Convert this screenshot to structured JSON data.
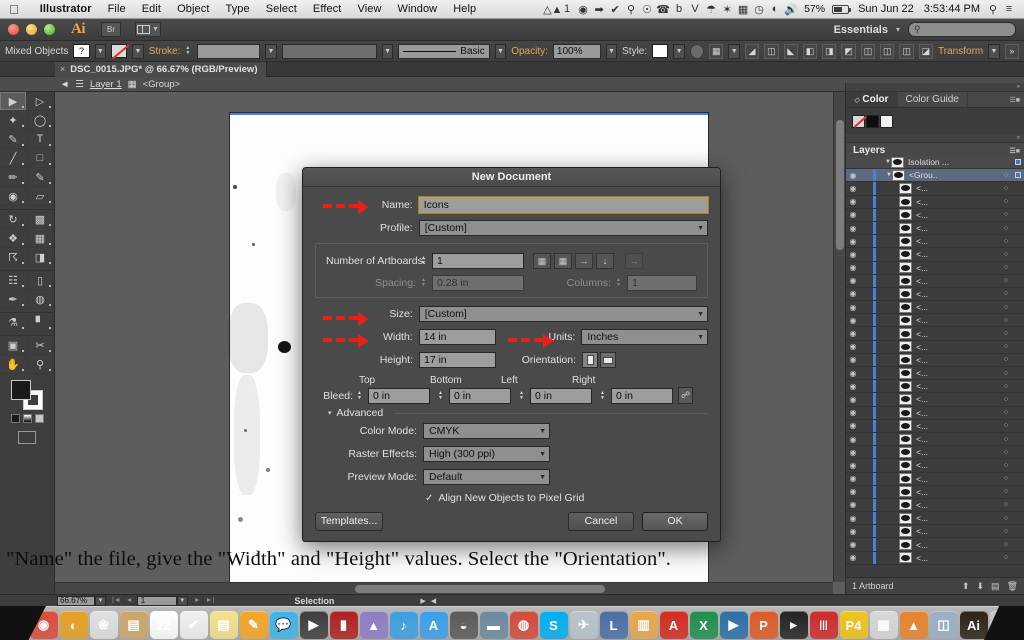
{
  "macbar": {
    "apple": "apple-logo",
    "menus": [
      "Illustrator",
      "File",
      "Edit",
      "Object",
      "Type",
      "Select",
      "Effect",
      "View",
      "Window",
      "Help"
    ],
    "status_items": [
      "Ⅶ",
      "1",
      "⚙",
      "➡",
      "◉",
      "♀",
      "⌂",
      "☎",
      "b",
      "V²",
      "☂",
      "✳",
      "▦",
      "◷"
    ],
    "battery_percent": "57%",
    "date": "Sun Jun 22",
    "time": "3:53:44 PM",
    "search_icon": "search-icon",
    "list_icon": "notification-center-icon"
  },
  "appbar": {
    "app_logo": "Ai",
    "bridge_label": "Br",
    "workspace": "Essentials",
    "workspace_caret": "▾",
    "search_placeholder": ""
  },
  "controlbar": {
    "selection_label": "Mixed Objects",
    "fill_value": "?",
    "stroke_label": "Stroke:",
    "stroke_weight": "",
    "profile_label": "Basic",
    "opacity_label": "Opacity:",
    "opacity_value": "100%",
    "style_label": "Style:",
    "transform_label": "Transform",
    "align_icons": [
      "align-left-icon",
      "align-center-h-icon",
      "align-right-icon",
      "align-top-icon",
      "align-middle-icon",
      "align-bottom-icon",
      "distribute-left-icon",
      "distribute-center-icon",
      "distribute-right-icon",
      "distribute-spacing-icon"
    ]
  },
  "document": {
    "tab_title": "DSC_0015.JPG* @ 66.67% (RGB/Preview)",
    "tab_close": "×",
    "breadcrumb_back": "◄",
    "breadcrumb_layer": "Layer 1",
    "breadcrumb_group": "<Group>"
  },
  "toolbox": {
    "tools": [
      "selection-tool",
      "direct-selection-tool",
      "magic-wand-tool",
      "lasso-tool",
      "pen-tool",
      "type-tool",
      "line-segment-tool",
      "rectangle-tool",
      "paintbrush-tool",
      "pencil-tool",
      "blob-brush-tool",
      "eraser-tool",
      "rotate-tool",
      "scale-tool",
      "width-tool",
      "free-transform-tool",
      "shape-builder-tool",
      "perspective-grid-tool",
      "mesh-tool",
      "gradient-tool",
      "eyedropper-tool",
      "blend-tool",
      "symbol-sprayer-tool",
      "column-graph-tool",
      "artboard-tool",
      "slice-tool",
      "hand-tool",
      "zoom-tool"
    ],
    "fill_swatch": "fill-swatch",
    "stroke_swatch": "stroke-swatch",
    "screen_mode": "screen-mode-icon"
  },
  "dialog": {
    "title": "New Document",
    "name_label": "Name:",
    "name_value": "Icons",
    "profile_label": "Profile:",
    "profile_value": "[Custom]",
    "artboards_label": "Number of Artboards:",
    "artboards_value": "1",
    "artboard_layout_icons": [
      "grid-by-row-icon",
      "grid-by-column-icon",
      "arrange-by-row-icon",
      "arrange-by-column-icon",
      "change-to-right-to-left-icon"
    ],
    "spacing_label": "Spacing:",
    "spacing_value": "0.28 in",
    "columns_label": "Columns:",
    "columns_value": "1",
    "size_label": "Size:",
    "size_value": "[Custom]",
    "width_label": "Width:",
    "width_value": "14 in",
    "units_label": "Units:",
    "units_value": "Inches",
    "height_label": "Height:",
    "height_value": "17 in",
    "orientation_label": "Orientation:",
    "orientation_portrait": "portrait-orientation-icon",
    "orientation_landscape": "landscape-orientation-icon",
    "bleed_label": "Bleed:",
    "bleed_headers": [
      "Top",
      "Bottom",
      "Left",
      "Right"
    ],
    "bleed_values": [
      "0 in",
      "0 in",
      "0 in",
      "0 in"
    ],
    "bleed_link": "link-bleed-icon",
    "advanced_label": "Advanced",
    "advanced_triangle": "▾",
    "color_mode_label": "Color Mode:",
    "color_mode_value": "CMYK",
    "raster_label": "Raster Effects:",
    "raster_value": "High (300 ppi)",
    "preview_label": "Preview Mode:",
    "preview_value": "Default",
    "align_pixel_label": "Align New Objects to Pixel Grid",
    "align_pixel_checked": "✓",
    "templates_button": "Templates...",
    "cancel_button": "Cancel",
    "ok_button": "OK"
  },
  "annotations": {
    "arrow_color": "#e8201a",
    "arrows": [
      "name-arrow",
      "width-arrow",
      "height-arrow",
      "orientation-arrow"
    ]
  },
  "panels": {
    "color_tab": "Color",
    "color_guide_tab": "Color Guide",
    "layers_tab": "Layers",
    "layer_rows": [
      {
        "name": "Isolation ...",
        "type": "isolation"
      },
      {
        "name": "<Grou..",
        "type": "group-selected"
      },
      {
        "name": "<...",
        "type": "item"
      },
      {
        "name": "<...",
        "type": "item"
      },
      {
        "name": "<...",
        "type": "item"
      },
      {
        "name": "<...",
        "type": "item"
      },
      {
        "name": "<...",
        "type": "item"
      },
      {
        "name": "<...",
        "type": "item"
      },
      {
        "name": "<...",
        "type": "item"
      },
      {
        "name": "<...",
        "type": "item"
      },
      {
        "name": "<...",
        "type": "item"
      },
      {
        "name": "<...",
        "type": "item"
      },
      {
        "name": "<...",
        "type": "item"
      },
      {
        "name": "<...",
        "type": "item"
      },
      {
        "name": "<...",
        "type": "item"
      },
      {
        "name": "<...",
        "type": "item"
      },
      {
        "name": "<...",
        "type": "item"
      },
      {
        "name": "<...",
        "type": "item"
      },
      {
        "name": "<...",
        "type": "item"
      },
      {
        "name": "<...",
        "type": "item"
      },
      {
        "name": "<...",
        "type": "item"
      },
      {
        "name": "<...",
        "type": "item"
      },
      {
        "name": "<...",
        "type": "item"
      },
      {
        "name": "<...",
        "type": "item"
      },
      {
        "name": "<...",
        "type": "item"
      },
      {
        "name": "<...",
        "type": "item"
      },
      {
        "name": "<...",
        "type": "item"
      },
      {
        "name": "<...",
        "type": "item"
      },
      {
        "name": "<...",
        "type": "item"
      },
      {
        "name": "<...",
        "type": "item"
      },
      {
        "name": "<...",
        "type": "item"
      }
    ],
    "layers_footer_icons": [
      "make-clipping-mask-icon",
      "create-sublayer-icon",
      "create-layer-icon",
      "delete-layer-icon"
    ]
  },
  "statusbar": {
    "zoom_value": "66.67%",
    "page_value": "1",
    "tool_label": "Selection",
    "artboard_label": "1 Artboard",
    "nav_first": "|◄",
    "nav_prev": "◄",
    "nav_next": "►",
    "nav_last": "►|"
  },
  "caption": {
    "text": "\"Name\" the file, give the \"Width\" and \"Height\" values. Select the \"Orientation\"."
  },
  "dock": {
    "items": [
      {
        "name": "finder",
        "glyph": "☺",
        "color": "#4a90d9"
      },
      {
        "name": "launchpad",
        "glyph": "🚀",
        "color": "#b9bcc1"
      },
      {
        "name": "system-preferences",
        "glyph": "⚙",
        "color": "#7d8289"
      },
      {
        "name": "safari",
        "glyph": "◎",
        "color": "#2e8fd6"
      },
      {
        "name": "mail",
        "glyph": "✉",
        "color": "#3f8fe0"
      },
      {
        "name": "chrome",
        "glyph": "◉",
        "color": "#dd4b39"
      },
      {
        "name": "firefox",
        "glyph": "◐",
        "color": "#e8a020"
      },
      {
        "name": "photos",
        "glyph": "❀",
        "color": "#e0e0e0"
      },
      {
        "name": "documents-folder",
        "glyph": "▤",
        "color": "#cba56a"
      },
      {
        "name": "calendar",
        "glyph": "22",
        "color": "#ffffff"
      },
      {
        "name": "reminders",
        "glyph": "✔",
        "color": "#f0f0f0"
      },
      {
        "name": "notes",
        "glyph": "▤",
        "color": "#f2e28a"
      },
      {
        "name": "pages",
        "glyph": "✎",
        "color": "#f5a623"
      },
      {
        "name": "messages",
        "glyph": "💬",
        "color": "#3fb4e8"
      },
      {
        "name": "facetime",
        "glyph": "▶",
        "color": "#3d3d3d"
      },
      {
        "name": "books",
        "glyph": "▮",
        "color": "#b02020"
      },
      {
        "name": "itunes-movie",
        "glyph": "▲",
        "color": "#8e7cc3"
      },
      {
        "name": "itunes",
        "glyph": "♪",
        "color": "#3aa0e0"
      },
      {
        "name": "app-store",
        "glyph": "A",
        "color": "#39a0ec"
      },
      {
        "name": "ubuntu",
        "glyph": "◒",
        "color": "#5a5a5a"
      },
      {
        "name": "vmware",
        "glyph": "▬",
        "color": "#6d8aa0"
      },
      {
        "name": "popcorn-time",
        "glyph": "◍",
        "color": "#d44a3a"
      },
      {
        "name": "skype",
        "glyph": "S",
        "color": "#00aff0"
      },
      {
        "name": "disk-utility",
        "glyph": "✈",
        "color": "#b8c4cc"
      },
      {
        "name": "textedit",
        "glyph": "L",
        "color": "#4a6fa5"
      },
      {
        "name": "keynote",
        "glyph": "▥",
        "color": "#e8a84a"
      },
      {
        "name": "acrobat",
        "glyph": "A",
        "color": "#d42b1e"
      },
      {
        "name": "excel",
        "glyph": "X",
        "color": "#1d8f4e"
      },
      {
        "name": "quicktime",
        "glyph": "▶",
        "color": "#2b6fa8"
      },
      {
        "name": "pixelmator",
        "glyph": "P",
        "color": "#e05a28"
      },
      {
        "name": "terminal",
        "glyph": "▸",
        "color": "#222222"
      },
      {
        "name": "parallels",
        "glyph": "|||",
        "color": "#cf2a2a"
      },
      {
        "name": "perforce",
        "glyph": "P4",
        "color": "#f0c419"
      },
      {
        "name": "calculator",
        "glyph": "▦",
        "color": "#d8d8d8"
      },
      {
        "name": "vlc",
        "glyph": "▲",
        "color": "#e8832a"
      },
      {
        "name": "preview",
        "glyph": "◫",
        "color": "#9ab0c4"
      },
      {
        "name": "illustrator",
        "glyph": "Ai",
        "color": "#2b2113"
      },
      {
        "name": "help",
        "glyph": "?",
        "color": "#c8c8c8"
      },
      {
        "name": "utilities-folder",
        "glyph": "▣",
        "color": "#b0b4ba"
      },
      {
        "name": "downloads-folder",
        "glyph": "▤",
        "color": "#9fc4e0"
      },
      {
        "name": "documents-stack",
        "glyph": "▭",
        "color": "#eaeaea"
      },
      {
        "name": "trash",
        "glyph": "▽",
        "color": "#b8bcc2"
      }
    ]
  }
}
